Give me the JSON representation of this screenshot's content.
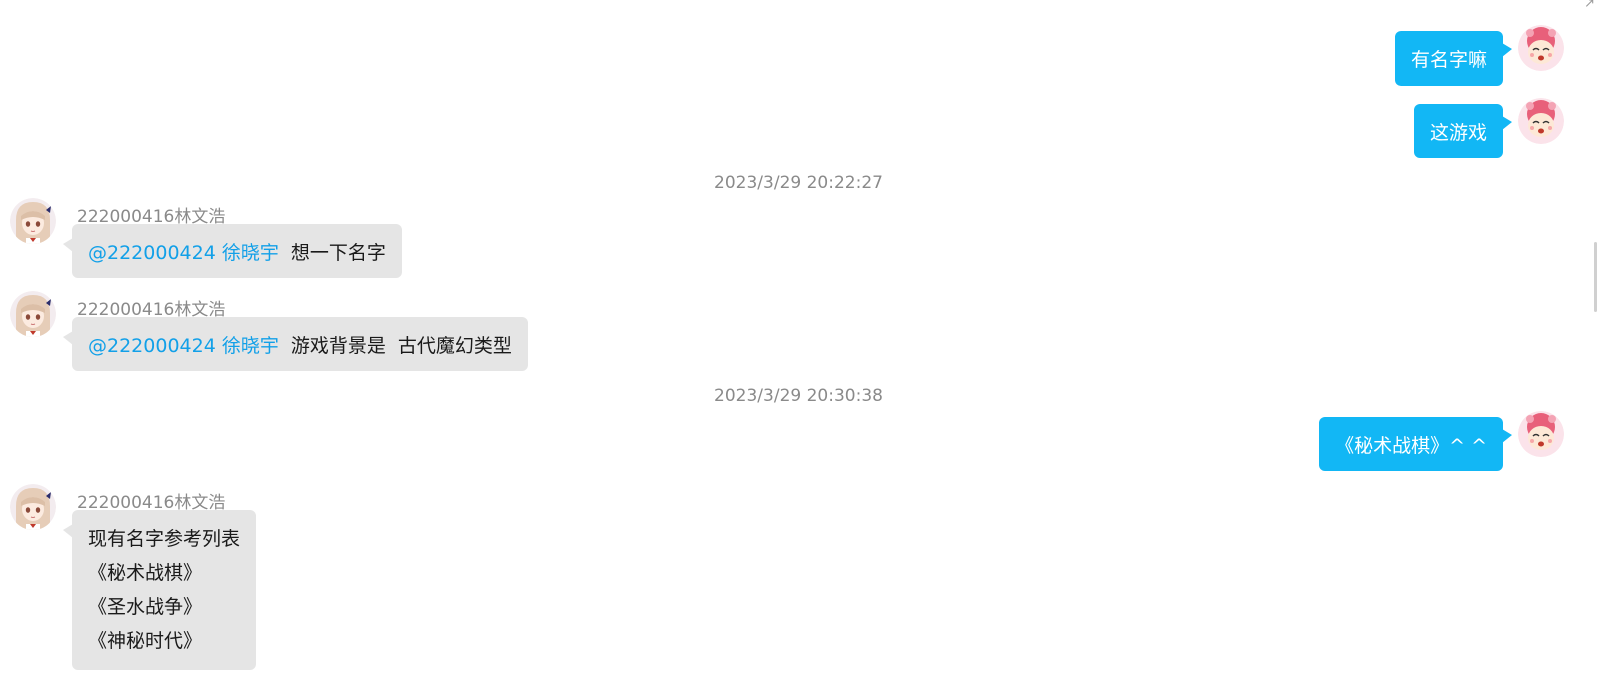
{
  "messages": [
    {
      "text": "有名字嘛"
    },
    {
      "text": "这游戏"
    },
    {
      "sender": "222000416林文浩",
      "mention": "@222000424 徐晓宇",
      "text": "想一下名字"
    },
    {
      "sender": "222000416林文浩",
      "mention": "@222000424 徐晓宇",
      "text": "游戏背景是  古代魔幻类型"
    },
    {
      "text": "《秘术战棋》^ ^"
    },
    {
      "sender": "222000416林文浩",
      "lines": [
        "现有名字参考列表",
        "《秘术战棋》",
        "《圣水战争》",
        "《神秘时代》"
      ]
    }
  ],
  "timestamps": [
    "2023/3/29 20:22:27",
    "2023/3/29 20:30:38"
  ],
  "colors": {
    "self_bubble": "#12b7f5",
    "other_bubble": "#e5e5e5",
    "mention": "#12a0e8",
    "meta_text": "#8a8a8a"
  },
  "icons": {
    "self_avatar": "pink-creature-avatar-icon",
    "other_avatar": "anime-girl-avatar-icon"
  }
}
